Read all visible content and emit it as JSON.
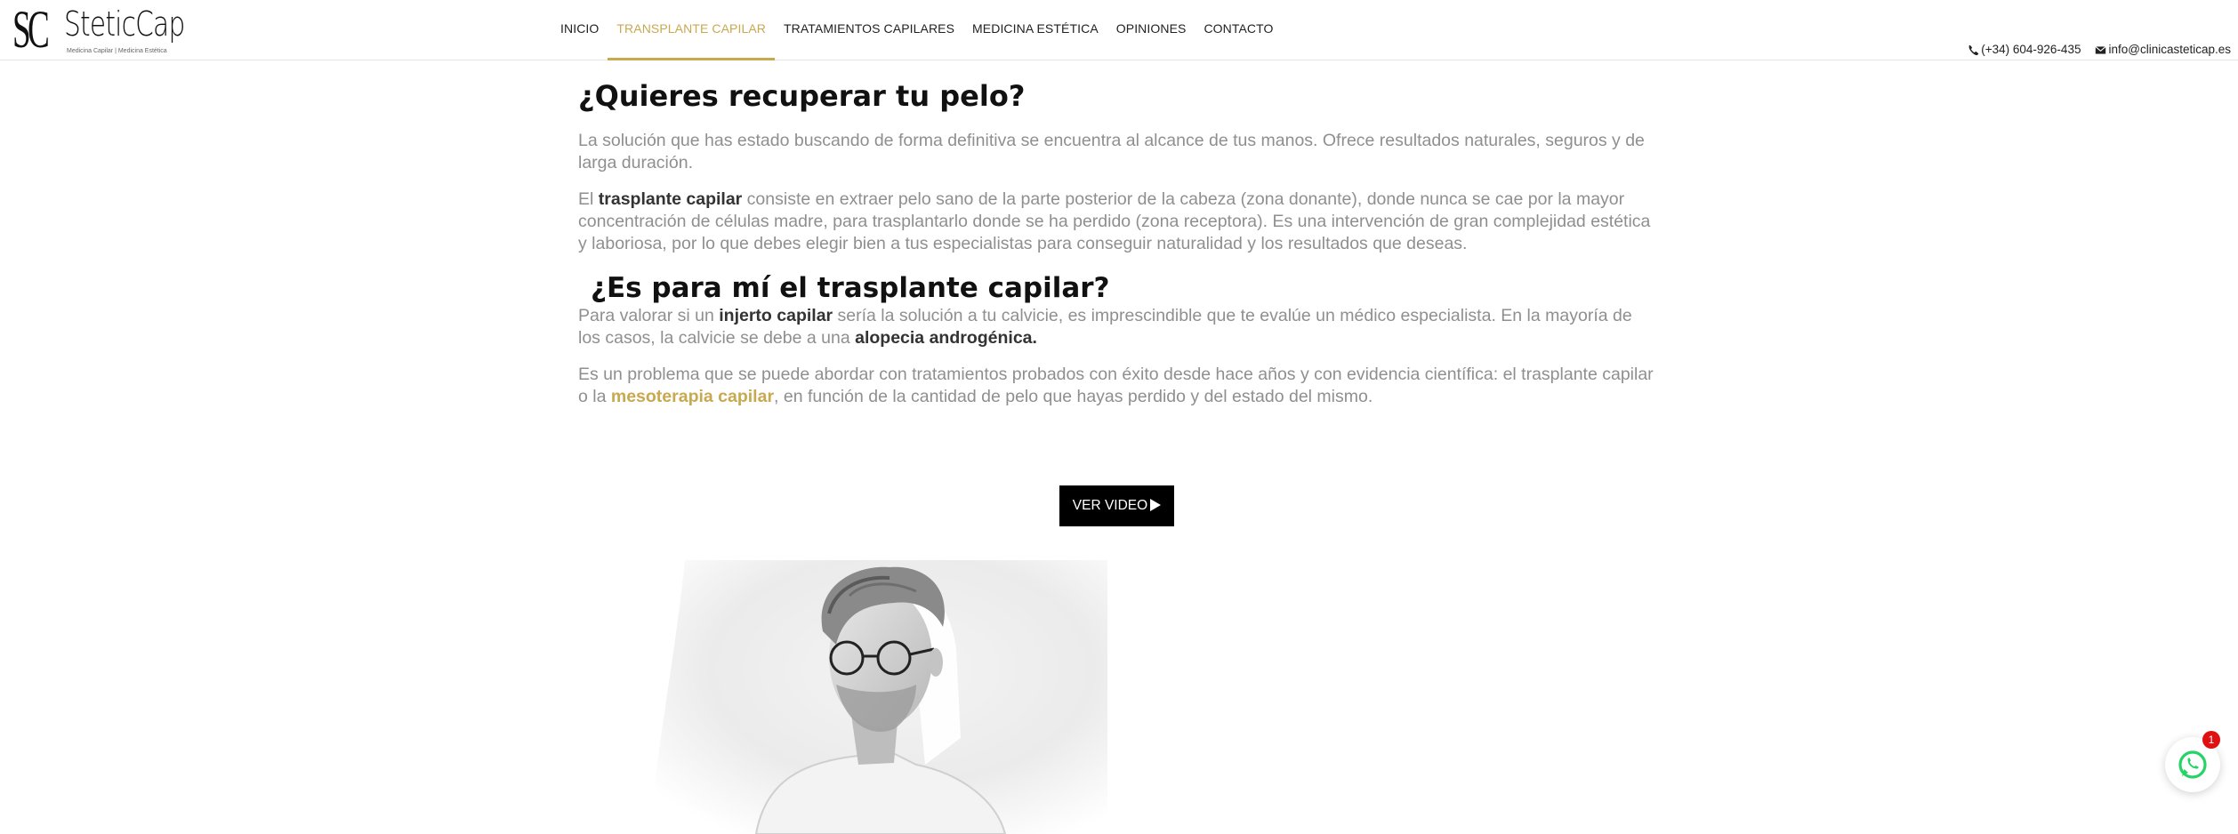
{
  "header": {
    "logo": {
      "monogram": "SC",
      "name": "SteticCap",
      "tagline": "Medicina Capilar | Medicina Estética"
    },
    "nav": [
      {
        "label": "INICIO"
      },
      {
        "label": "TRANSPLANTE CAPILAR",
        "active": true
      },
      {
        "label": "TRATAMIENTOS CAPILARES"
      },
      {
        "label": "MEDICINA ESTÉTICA"
      },
      {
        "label": "OPINIONES"
      },
      {
        "label": "CONTACTO"
      }
    ],
    "phone": "(+34) 604-926-435",
    "email": "info@clinicasteticap.es",
    "accent_color": "#c9a94f"
  },
  "main": {
    "heading1": "¿Quieres recuperar tu pelo?",
    "p1": "La solución que has estado buscando de forma definitiva se encuentra al alcance de tus manos. Ofrece resultados naturales, seguros y de larga duración.",
    "p2_pre": "El ",
    "p2_bold": "trasplante capilar",
    "p2_post": " consiste en extraer pelo sano de la parte posterior de la cabeza (zona donante), donde nunca se cae por la mayor concentración de células madre, para trasplantarlo donde se ha perdido (zona receptora). Es una intervención de gran complejidad estética y laboriosa, por lo que debes elegir bien a tus especialistas para conseguir naturalidad y los resultados que deseas.",
    "heading2": "¿Es para mí el trasplante capilar?",
    "p3_pre": "Para valorar si un ",
    "p3_bold1": "injerto capilar",
    "p3_mid": " sería la solución a tu calvicie, es imprescindible que te evalúe un médico especialista. En la mayoría de los casos, la calvicie se debe a una ",
    "p3_bold2": "alopecia androgénica.",
    "p4_pre": "Es un problema que se puede abordar con tratamientos probados con éxito desde hace años y con evidencia científica: el trasplante capilar o la ",
    "p4_link": "mesoterapia capilar",
    "p4_post": ", en función de la cantidad de pelo que hayas perdido y del estado del mismo.",
    "video_button": "VER VIDEO",
    "photo_icon": "man-with-glasses-photo"
  },
  "whatsapp": {
    "icon": "whatsapp-icon",
    "badge": "1",
    "color": "#25d366"
  }
}
